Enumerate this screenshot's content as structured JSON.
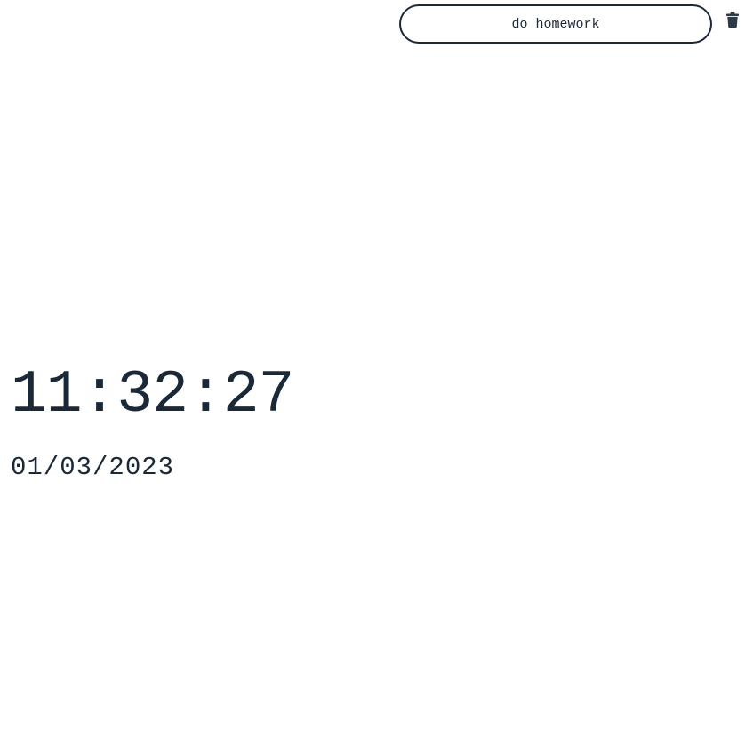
{
  "todo": {
    "items": [
      {
        "label": "do homework"
      }
    ],
    "delete_icon": "trash-icon"
  },
  "clock": {
    "time": "11:32:27",
    "date": "01/03/2023"
  },
  "colors": {
    "text": "#1b2838",
    "background": "#ffffff",
    "icon": "#2d3a4a"
  }
}
